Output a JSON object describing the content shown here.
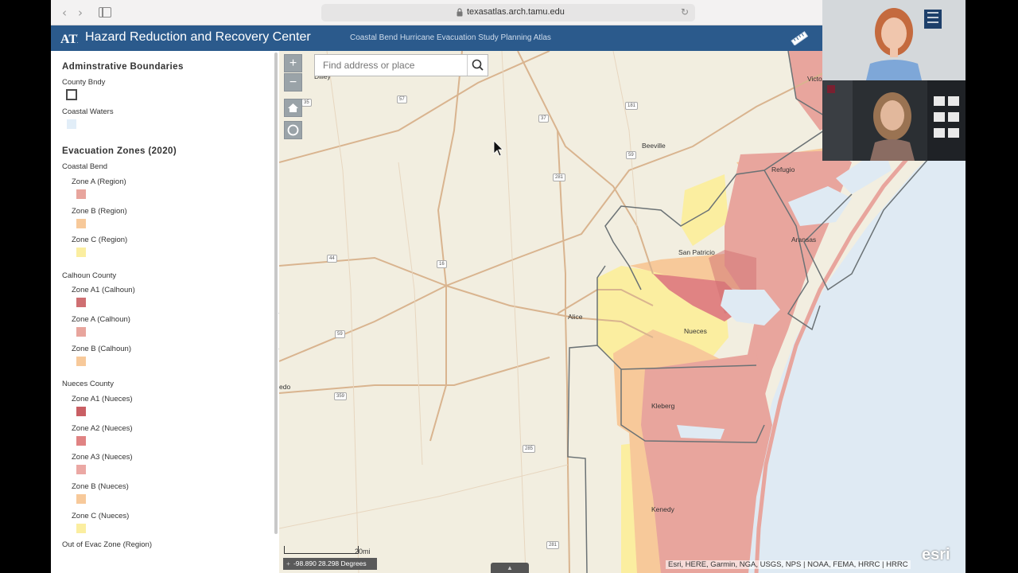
{
  "browser": {
    "url": "texasatlas.arch.tamu.edu",
    "back_glyph": "‹",
    "forward_glyph": "›",
    "reload_glyph": "↻"
  },
  "app": {
    "title": "Hazard Reduction and Recovery Center",
    "subtitle": "Coastal Bend Hurricane Evacuation Study Planning Atlas",
    "header_color": "#2b5a8c"
  },
  "legend": {
    "sections": [
      {
        "heading": "Adminstrative Boundaries",
        "groups": [
          {
            "label": "County Bndy",
            "type": "outline"
          },
          {
            "label": "Coastal Waters",
            "color": "#e2eef8"
          }
        ]
      },
      {
        "heading": "Evacuation Zones (2020)",
        "subgroups": [
          {
            "label": "Coastal Bend",
            "items": [
              {
                "label": "Zone A (Region)",
                "color": "#e8a59d"
              },
              {
                "label": "Zone B (Region)",
                "color": "#f7c99a"
              },
              {
                "label": "Zone C (Region)",
                "color": "#fbeea0"
              }
            ]
          },
          {
            "label": "Calhoun County",
            "items": [
              {
                "label": "Zone A1 (Calhoun)",
                "color": "#cf6f72"
              },
              {
                "label": "Zone A (Calhoun)",
                "color": "#e8a59d"
              },
              {
                "label": "Zone B (Calhoun)",
                "color": "#f7c99a"
              }
            ]
          },
          {
            "label": "Nueces County",
            "items": [
              {
                "label": "Zone A1 (Nueces)",
                "color": "#c95f64"
              },
              {
                "label": "Zone A2 (Nueces)",
                "color": "#e08383"
              },
              {
                "label": "Zone A3 (Nueces)",
                "color": "#eba8a4"
              },
              {
                "label": "Zone B (Nueces)",
                "color": "#f7c99a"
              },
              {
                "label": "Zone C (Nueces)",
                "color": "#fbeea0"
              }
            ]
          },
          {
            "label": "Out of Evac Zone (Region)",
            "items": []
          }
        ]
      }
    ],
    "collapse_glyph": "‹"
  },
  "map": {
    "search_placeholder": "Find address or place",
    "zoom_in": "+",
    "zoom_out": "−",
    "scale_label": "20mi",
    "coordinates": "-98.890 28.298 Degrees",
    "coord_prefix": "+",
    "attribution": "Esri, HERE, Garmin, NGA, USGS, NPS | NOAA, FEMA, HRRC | HRRC",
    "esri_logo": "esri",
    "bottom_handle_glyph": "▲",
    "places": [
      {
        "name": "Dilley",
        "id": "dilley"
      },
      {
        "name": "Beeville",
        "id": "beeville"
      },
      {
        "name": "Refugio",
        "id": "refugio"
      },
      {
        "name": "Aransas",
        "id": "aransas"
      },
      {
        "name": "San Patricio",
        "id": "san-patricio"
      },
      {
        "name": "Alice",
        "id": "alice"
      },
      {
        "name": "Nueces",
        "id": "nueces"
      },
      {
        "name": "Kleberg",
        "id": "kleberg"
      },
      {
        "name": "Kenedy",
        "id": "kenedy"
      },
      {
        "name": "Victo",
        "id": "victoria"
      },
      {
        "name": "edo",
        "id": "laredo"
      }
    ],
    "shields": [
      "35",
      "57",
      "37",
      "181",
      "59",
      "281",
      "44",
      "16",
      "59",
      "359",
      "285",
      "281"
    ],
    "colors": {
      "land": "#f2eee0",
      "water": "#dfeaf3",
      "road": "#d9b48f",
      "county_line": "#6b7275",
      "zone_a": "#e8a59d",
      "zone_b": "#f7c99a",
      "zone_c": "#fbeea0"
    }
  },
  "video": {
    "participant_1": "presenter",
    "participant_2": "participant"
  }
}
